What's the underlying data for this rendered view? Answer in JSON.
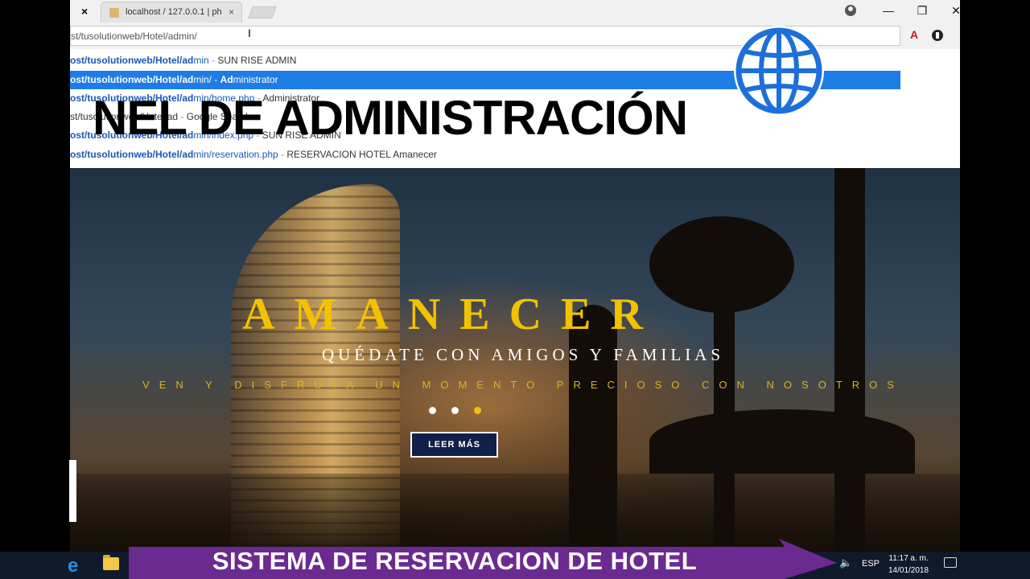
{
  "browser": {
    "tab_title": "localhost / 127.0.0.1 | ph",
    "tab_close": "×",
    "window_buttons": {
      "minimize": "—",
      "restore": "❐",
      "close": "✕"
    },
    "address": "st/tusolutionweb/Hotel/admin/",
    "pdf_icon": "A"
  },
  "suggestions": [
    {
      "url_bold": "ost/tusolutionweb/Hotel/ad",
      "url_rest": "min",
      "sep": " - ",
      "title": "SUN RISE ADMIN"
    },
    {
      "url_bold": "ost/tusolutionweb/Hotel/ad",
      "url_rest": "min/",
      "sep": " - ",
      "title_bold": "Ad",
      "title": "ministrator"
    },
    {
      "url_bold": "ost/tusolutionweb/Hotel/ad",
      "url_rest": "min/home.php",
      "sep": " - ",
      "title": "Administrator"
    },
    {
      "url_bold": "",
      "url_rest": "st/tusolutionweb/Hotel/ad",
      "sep": " - ",
      "title": "Google Search"
    },
    {
      "url_bold": "ost/tusolutionweb/Hotel/ad",
      "url_rest": "min/index.php",
      "sep": " - ",
      "title": "SUN RISE ADMIN"
    },
    {
      "url_bold": "ost/tusolutionweb/Hotel/ad",
      "url_rest": "min/reservation.php",
      "sep": " - ",
      "title": "RESERVACION HOTEL Amanecer"
    }
  ],
  "overlay": {
    "headline": "NEL DE ADMINISTRACIÓN",
    "banner": "SISTEMA DE RESERVACION DE HOTEL",
    "banner_color": "#6b2a8f"
  },
  "hero": {
    "title": "AMANECER",
    "subtitle": "QUÉDATE CON AMIGOS Y FAMILIAS",
    "tagline": "VEN Y DISFRUTA UN MOMENTO PRECIOSO CON NOSOTROS",
    "button": "LEER MÁS",
    "slides": 3,
    "active_slide": 3,
    "accent": "#f2c200"
  },
  "taskbar": {
    "lang": "ESP",
    "time": "11:17 a. m.",
    "date": "14/01/2018",
    "edge_icon": "e"
  }
}
